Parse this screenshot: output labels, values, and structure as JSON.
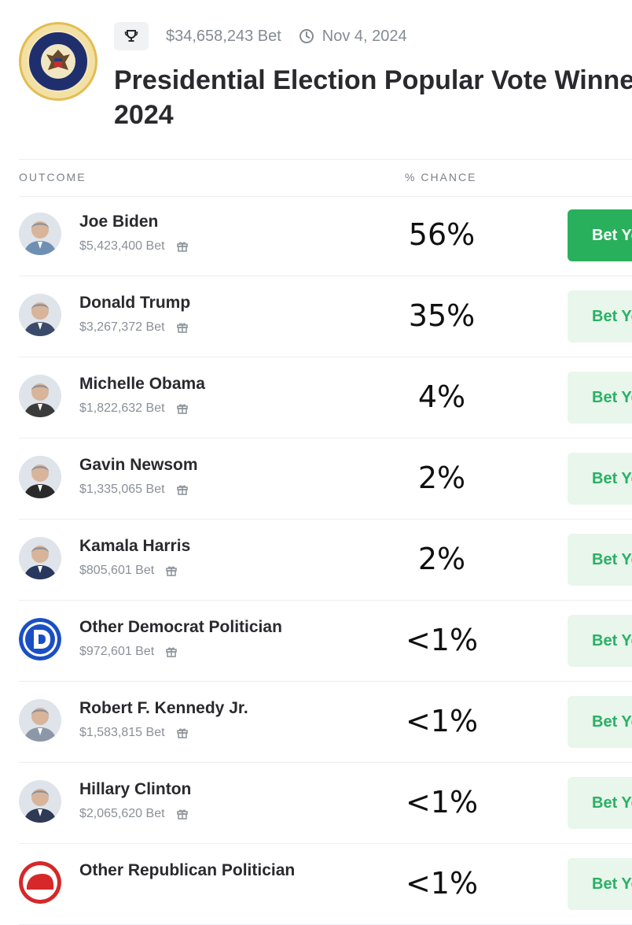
{
  "market": {
    "volume": "$34,658,243 Bet",
    "date": "Nov 4, 2024",
    "title_line1": "Presidential Election Popular Vote Winner",
    "title_line2": "2024",
    "icons": {
      "trophy": "trophy-icon",
      "clock": "clock-icon",
      "seal": "presidential-seal-icon"
    }
  },
  "table": {
    "col_outcome": "OUTCOME",
    "col_chance": "% CHANCE",
    "button_label": "Bet Yes",
    "accent": "#29b05d",
    "accent_light": "#e8f6ec",
    "rows": [
      {
        "name": "Joe Biden",
        "bet": "$5,423,400 Bet",
        "chance": "56%",
        "primary": true,
        "avatar_color": "#6f8fb3"
      },
      {
        "name": "Donald Trump",
        "bet": "$3,267,372 Bet",
        "chance": "35%",
        "primary": false,
        "avatar_color": "#3a4a6a"
      },
      {
        "name": "Michelle Obama",
        "bet": "$1,822,632 Bet",
        "chance": "4%",
        "primary": false,
        "avatar_color": "#3b3b3b"
      },
      {
        "name": "Gavin Newsom",
        "bet": "$1,335,065 Bet",
        "chance": "2%",
        "primary": false,
        "avatar_color": "#2a2a2a"
      },
      {
        "name": "Kamala Harris",
        "bet": "$805,601 Bet",
        "chance": "2%",
        "primary": false,
        "avatar_color": "#27375e"
      },
      {
        "name": "Other Democrat Politician",
        "bet": "$972,601 Bet",
        "chance": "<1%",
        "primary": false,
        "avatar_color": "#1a4fc4"
      },
      {
        "name": "Robert F. Kennedy Jr.",
        "bet": "$1,583,815 Bet",
        "chance": "<1%",
        "primary": false,
        "avatar_color": "#8c98a8"
      },
      {
        "name": "Hillary Clinton",
        "bet": "$2,065,620 Bet",
        "chance": "<1%",
        "primary": false,
        "avatar_color": "#2f3a55"
      },
      {
        "name": "Other Republican Politician",
        "bet": "",
        "chance": "<1%",
        "primary": false,
        "avatar_color": "#d62828"
      }
    ]
  }
}
